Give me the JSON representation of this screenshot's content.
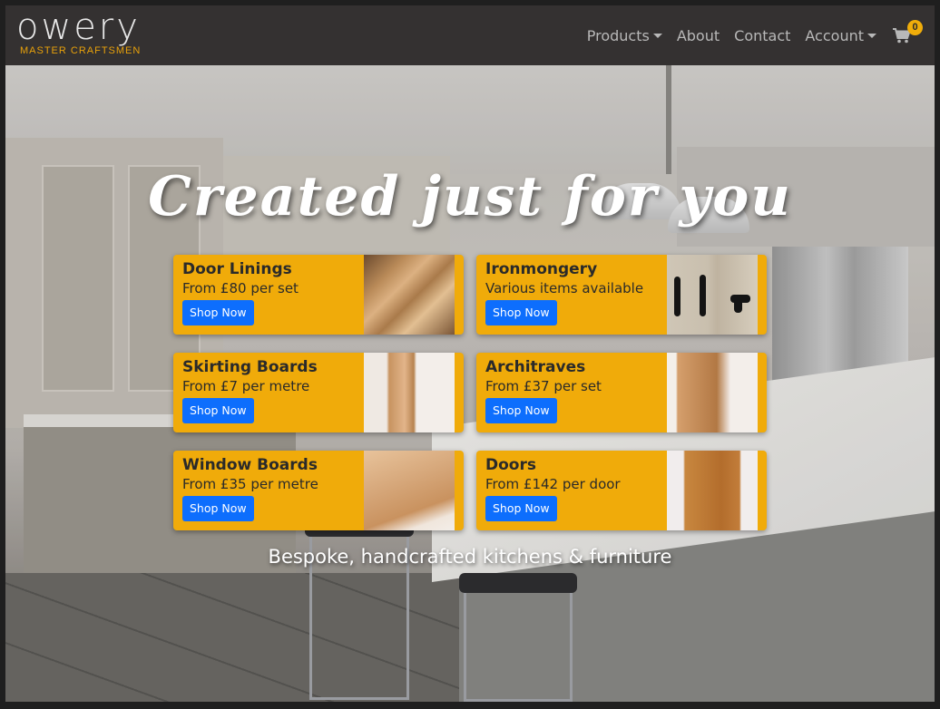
{
  "brand": {
    "name": "owery",
    "tagline": "MASTER CRAFTSMEN",
    "accent": "#f0ab0a"
  },
  "nav": {
    "items": [
      {
        "label": "Products",
        "dropdown": true
      },
      {
        "label": "About",
        "dropdown": false
      },
      {
        "label": "Contact",
        "dropdown": false
      },
      {
        "label": "Account",
        "dropdown": true
      }
    ],
    "cart": {
      "icon": "shopping-cart-icon",
      "count": "0"
    }
  },
  "hero": {
    "headline": "Created just for you",
    "subheadline": "Bespoke, handcrafted kitchens & furniture"
  },
  "products": [
    {
      "title": "Door Linings",
      "price": "From £80 per set",
      "button": "Shop Now",
      "image": "door-linings-image"
    },
    {
      "title": "Ironmongery",
      "price": "Various items available",
      "button": "Shop Now",
      "image": "ironmongery-image"
    },
    {
      "title": "Skirting Boards",
      "price": "From £7 per metre",
      "button": "Shop Now",
      "image": "skirting-boards-image"
    },
    {
      "title": "Architraves",
      "price": "From £37 per set",
      "button": "Shop Now",
      "image": "architraves-image"
    },
    {
      "title": "Window Boards",
      "price": "From £35 per metre",
      "button": "Shop Now",
      "image": "window-boards-image"
    },
    {
      "title": "Doors",
      "price": "From £142 per door",
      "button": "Shop Now",
      "image": "doors-image"
    }
  ],
  "colors": {
    "navbar": "#343131",
    "card": "#f0ab0a",
    "button": "#0d6efd"
  }
}
